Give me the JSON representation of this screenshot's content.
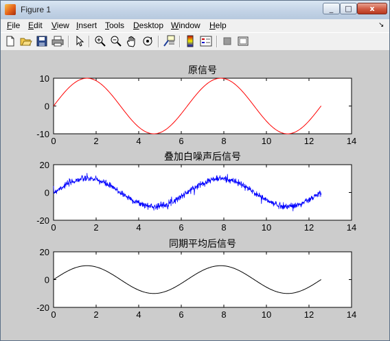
{
  "window": {
    "title": "Figure 1"
  },
  "title_buttons": {
    "minimize": "_",
    "maximize": "□",
    "close": "x"
  },
  "menu": [
    {
      "mnemonic": "F",
      "rest": "ile"
    },
    {
      "mnemonic": "E",
      "rest": "dit"
    },
    {
      "mnemonic": "V",
      "rest": "iew"
    },
    {
      "mnemonic": "I",
      "rest": "nsert"
    },
    {
      "mnemonic": "T",
      "rest": "ools"
    },
    {
      "mnemonic": "D",
      "rest": "esktop"
    },
    {
      "mnemonic": "W",
      "rest": "indow"
    },
    {
      "mnemonic": "H",
      "rest": "elp"
    }
  ],
  "menu_overflow": "↘",
  "toolbar_icons": [
    "new-file-icon",
    "open-folder-icon",
    "save-icon",
    "print-icon",
    "pointer-icon",
    "zoom-in-icon",
    "zoom-out-icon",
    "pan-hand-icon",
    "rotate-3d-icon",
    "data-cursor-icon",
    "colorbar-icon",
    "legend-icon",
    "hide-plot-tools-icon",
    "show-plot-tools-icon"
  ],
  "chart_data": [
    {
      "type": "line",
      "title": "原信号",
      "xlim": [
        0,
        14
      ],
      "ylim": [
        -10,
        10
      ],
      "xticks": [
        "0",
        "2",
        "4",
        "6",
        "8",
        "10",
        "12",
        "14"
      ],
      "yticks": [
        "10",
        "0",
        "-10"
      ],
      "series": [
        {
          "function": "10*sin(x)",
          "x_range": [
            0,
            12.57
          ],
          "color": "#ff0000",
          "noise": 0
        }
      ]
    },
    {
      "type": "line",
      "title": "叠加白噪声后信号",
      "xlim": [
        0,
        14
      ],
      "ylim": [
        -20,
        20
      ],
      "xticks": [
        "0",
        "2",
        "4",
        "6",
        "8",
        "10",
        "12",
        "14"
      ],
      "yticks": [
        "20",
        "0",
        "-20"
      ],
      "series": [
        {
          "function": "10*sin(x) + noise",
          "x_range": [
            0,
            12.57
          ],
          "color": "#0000ff",
          "noise": 1.2
        }
      ]
    },
    {
      "type": "line",
      "title": "同期平均后信号",
      "xlim": [
        0,
        14
      ],
      "ylim": [
        -20,
        20
      ],
      "xticks": [
        "0",
        "2",
        "4",
        "6",
        "8",
        "10",
        "12",
        "14"
      ],
      "yticks": [
        "20",
        "0",
        "-20"
      ],
      "series": [
        {
          "function": "10*sin(x)",
          "x_range": [
            0,
            12.57
          ],
          "color": "#000000",
          "noise": 0
        }
      ]
    }
  ]
}
